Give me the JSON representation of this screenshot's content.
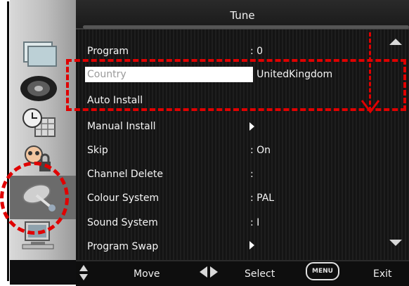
{
  "window": {
    "title": "Tune"
  },
  "menu": {
    "items": [
      {
        "label": "Program",
        "value": ": 0",
        "submenu": false,
        "highlighted": false
      },
      {
        "label": "Country",
        "value": ": UnitedKingdom",
        "submenu": false,
        "highlighted": true
      },
      {
        "label": "Auto  Install",
        "value": "",
        "submenu": false,
        "highlighted": false
      },
      {
        "label": "Manual  Install",
        "value": "",
        "submenu": true,
        "highlighted": false
      },
      {
        "label": "Skip",
        "value": ": On",
        "submenu": false,
        "highlighted": false
      },
      {
        "label": "Channel  Delete",
        "value": ":",
        "submenu": false,
        "highlighted": false
      },
      {
        "label": "Colour  System",
        "value": ": PAL",
        "submenu": false,
        "highlighted": false
      },
      {
        "label": "Sound  System",
        "value": ": I",
        "submenu": false,
        "highlighted": false
      },
      {
        "label": "Program  Swap",
        "value": "",
        "submenu": true,
        "highlighted": false
      }
    ]
  },
  "sidebar": {
    "icons": [
      "picture-icon",
      "sound-icon",
      "timer-icon",
      "parental-lock-icon",
      "tune-satellite-icon",
      "pc-setup-icon"
    ],
    "selected": "tune-satellite-icon"
  },
  "footer": {
    "move_label": "Move",
    "select_label": "Select",
    "menu_badge": "MENU",
    "exit_label": "Exit"
  },
  "colors": {
    "annotation": "#e00000",
    "highlight_bg": "#ffffff",
    "panel_bg": "#1a1a1a"
  }
}
